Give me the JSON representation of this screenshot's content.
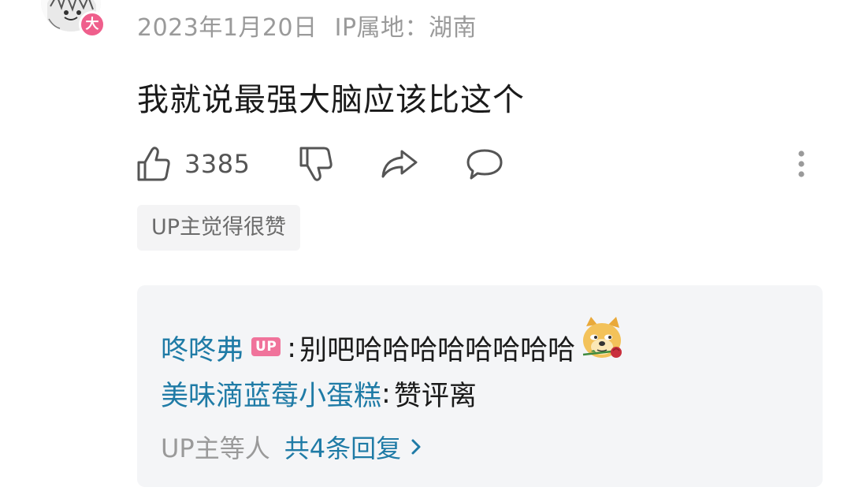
{
  "comment": {
    "level_badge": "大",
    "date": "2023年1月20日",
    "ip_location": "IP属地：湖南",
    "text": "我就说最强大脑应该比这个",
    "like_count": "3385",
    "up_liked_tag": "UP主觉得很赞"
  },
  "icons": {
    "like": "thumbs-up-icon",
    "dislike": "thumbs-down-icon",
    "share": "share-arrow-icon",
    "reply": "speech-bubble-icon",
    "more": "vertical-dots-icon",
    "emote": "doge-with-rose-emoji"
  },
  "replies": {
    "items": [
      {
        "user": "咚咚弗",
        "badge": "UP",
        "separator": ":",
        "text": "别吧哈哈哈哈哈哈哈哈"
      },
      {
        "user": "美味滴蓝莓小蛋糕",
        "separator": ":",
        "text": "赞评离"
      }
    ],
    "summary_prefix": "UP主等人",
    "summary_link": "共4条回复"
  },
  "colors": {
    "link_blue": "#1f7ba6",
    "up_badge_pink": "#f0739b",
    "level_badge_pink": "#ef5f8c",
    "meta_gray": "#9a9a9a",
    "reply_box_bg": "#f4f5f7"
  }
}
